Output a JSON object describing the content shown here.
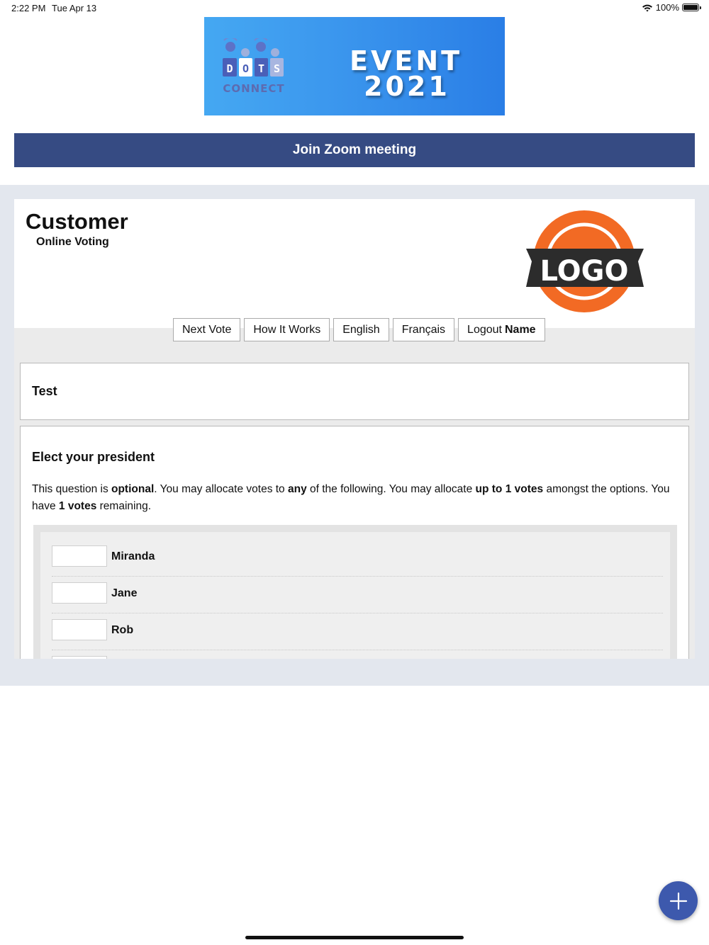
{
  "status_bar": {
    "time": "2:22 PM",
    "date": "Tue Apr 13",
    "battery": "100%"
  },
  "banner": {
    "dots_letters": [
      "D",
      "O",
      "T",
      "S"
    ],
    "connect": "CONNECT",
    "event": "EVENT",
    "year": "2021"
  },
  "zoom": {
    "label": "Join Zoom meeting"
  },
  "header": {
    "title": "Customer",
    "subtitle": "Online Voting",
    "logo_text": "LOGO"
  },
  "nav": {
    "next_vote": "Next Vote",
    "how_it_works": "How It Works",
    "english": "English",
    "francais": "Français",
    "logout": "Logout",
    "logout_name": "Name"
  },
  "section": {
    "title": "Test"
  },
  "question": {
    "title": "Elect your president",
    "t1": "This question is ",
    "b1": "optional",
    "t2": ". You may allocate votes to ",
    "b2": "any",
    "t3": " of the following. You may allocate ",
    "b3": "up to 1 votes",
    "t4": " amongst the options. You have ",
    "b4": "1 votes",
    "t5": " remaining."
  },
  "options": [
    {
      "label": "Miranda",
      "value": ""
    },
    {
      "label": "Jane",
      "value": ""
    },
    {
      "label": "Rob",
      "value": ""
    },
    {
      "label": "",
      "value": ""
    }
  ],
  "colors": {
    "zoom_bar": "#364b83",
    "fab": "#3d59ad",
    "logo_orange": "#f26a24",
    "page_bg": "#e3e7ee"
  }
}
